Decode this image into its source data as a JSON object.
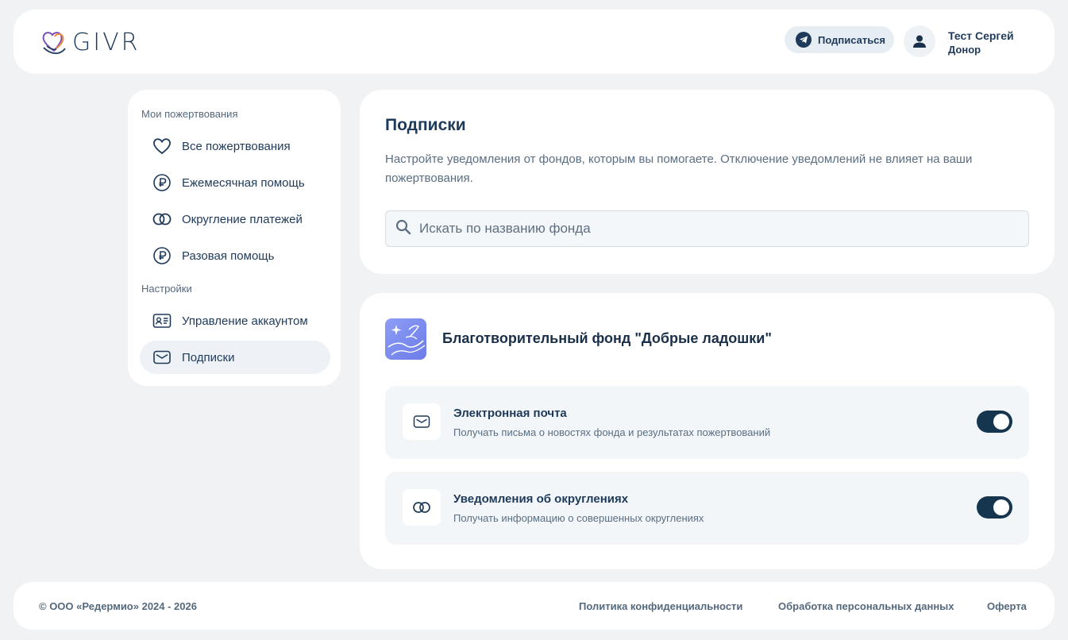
{
  "header": {
    "logo_text": "GIVR",
    "subscribe_label": "Подписаться",
    "user_name": "Тест Сергей",
    "user_role": "Донор"
  },
  "sidebar": {
    "group_donations": "Мои пожертвования",
    "items_donations": [
      {
        "label": "Все пожертвования",
        "icon": "heart-icon"
      },
      {
        "label": "Ежемесячная помощь",
        "icon": "ruble-icon"
      },
      {
        "label": "Округление платежей",
        "icon": "rings-icon"
      },
      {
        "label": "Разовая помощь",
        "icon": "ruble-icon"
      }
    ],
    "group_settings": "Настройки",
    "items_settings": [
      {
        "label": "Управление аккаунтом",
        "icon": "id-card-icon"
      },
      {
        "label": "Подписки",
        "icon": "envelope-icon",
        "active": true
      }
    ]
  },
  "main": {
    "title": "Подписки",
    "description": "Настройте уведомления от фондов, которым вы помогаете. Отключение уведомлений не влияет на ваши пожертвования.",
    "search": {
      "placeholder": "Искать по названию фонда",
      "value": ""
    }
  },
  "fund": {
    "name": "Благотворительный фонд \"Добрые ладошки\"",
    "notifications": [
      {
        "title": "Электронная почта",
        "description": "Получать письма о новостях фонда и результатах пожертвований",
        "icon": "envelope-icon",
        "enabled": true
      },
      {
        "title": "Уведомления об округлениях",
        "description": "Получать информацию о совершенных округлениях",
        "icon": "rings-icon",
        "enabled": true
      }
    ]
  },
  "footer": {
    "copyright": "© ООО «Редермио» 2024 - 2026",
    "links": [
      "Политика конфиденциальности",
      "Обработка персональных данных",
      "Оферта"
    ]
  },
  "colors": {
    "accent": "#16354f",
    "background": "#f1f2f4",
    "text": "#1e3a5a",
    "muted": "#5a6e82"
  }
}
